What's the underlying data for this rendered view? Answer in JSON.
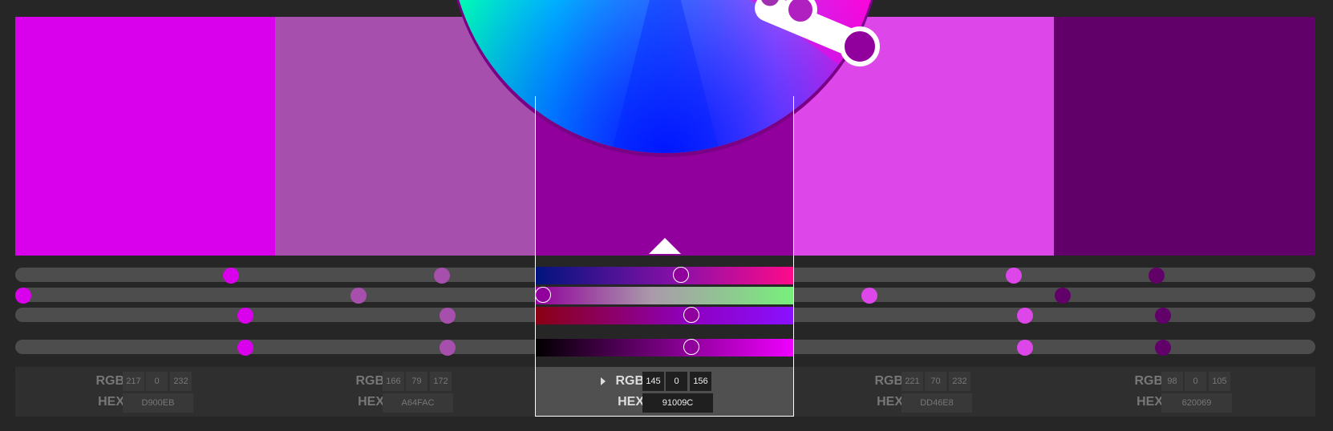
{
  "swatches": [
    {
      "color": "#D900EB",
      "rgb": [
        "217",
        "0",
        "232"
      ],
      "hex": "D900EB"
    },
    {
      "color": "#A64FAC",
      "rgb": [
        "166",
        "79",
        "172"
      ],
      "hex": "A64FAC"
    },
    {
      "color": "#91009C",
      "rgb": [
        "145",
        "0",
        "156"
      ],
      "hex": "91009C"
    },
    {
      "color": "#DD46E8",
      "rgb": [
        "221",
        "70",
        "232"
      ],
      "hex": "DD46E8"
    },
    {
      "color": "#620069",
      "rgb": [
        "98",
        "0",
        "105"
      ],
      "hex": "620069"
    }
  ],
  "labels": {
    "rgb": "RGB",
    "hex": "HEX"
  },
  "active_index": 2,
  "colors": {
    "background": "#262626",
    "track": "#4d4d4d",
    "panel": "#2f2f2f",
    "panel_active": "#505050"
  }
}
